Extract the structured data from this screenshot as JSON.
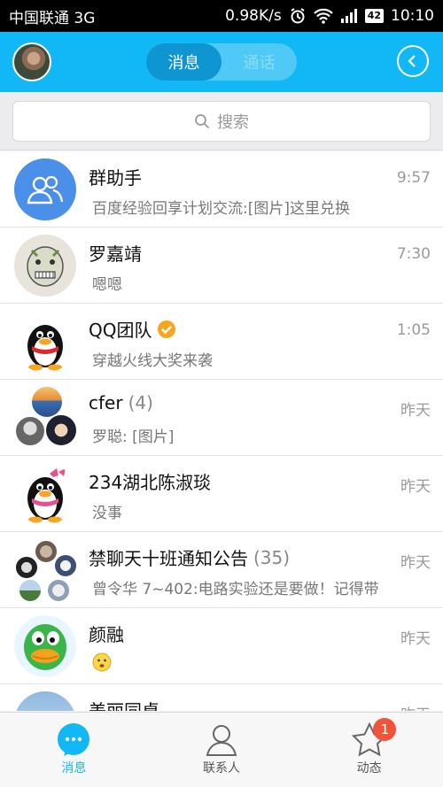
{
  "status_bar": {
    "carrier": "中国联通 3G",
    "speed": "0.98K/s",
    "battery": "42",
    "time": "10:10"
  },
  "header": {
    "tabs": [
      "消息",
      "通话"
    ]
  },
  "search": {
    "placeholder": "搜索"
  },
  "conversations": [
    {
      "name": "群助手",
      "count": "",
      "time": "9:57",
      "message": "百度经验回享计划交流:[图片]这里兑换"
    },
    {
      "name": "罗嘉靖",
      "count": "",
      "time": "7:30",
      "message": "嗯嗯"
    },
    {
      "name": "QQ团队",
      "count": "",
      "time": "1:05",
      "message": "穿越火线大奖来袭"
    },
    {
      "name": "cfer",
      "count": "(4)",
      "time": "昨天",
      "message": "罗聪: [图片]"
    },
    {
      "name": "234湖北陈淑琰",
      "count": "",
      "time": "昨天",
      "message": "没事"
    },
    {
      "name": "禁聊天十班通知公告",
      "count": "(35)",
      "time": "昨天",
      "message": "曾令华   7~402:电路实验还是要做！记得带"
    },
    {
      "name": "颜融",
      "count": "",
      "time": "昨天",
      "message": ""
    },
    {
      "name": "美丽同桌",
      "count": "",
      "time": "昨天",
      "message": ""
    }
  ],
  "tab_bar": {
    "items": [
      "消息",
      "联系人",
      "动态"
    ],
    "badge": "1"
  },
  "colors": {
    "accent": "#12b7f5",
    "badge": "#f0543a"
  }
}
